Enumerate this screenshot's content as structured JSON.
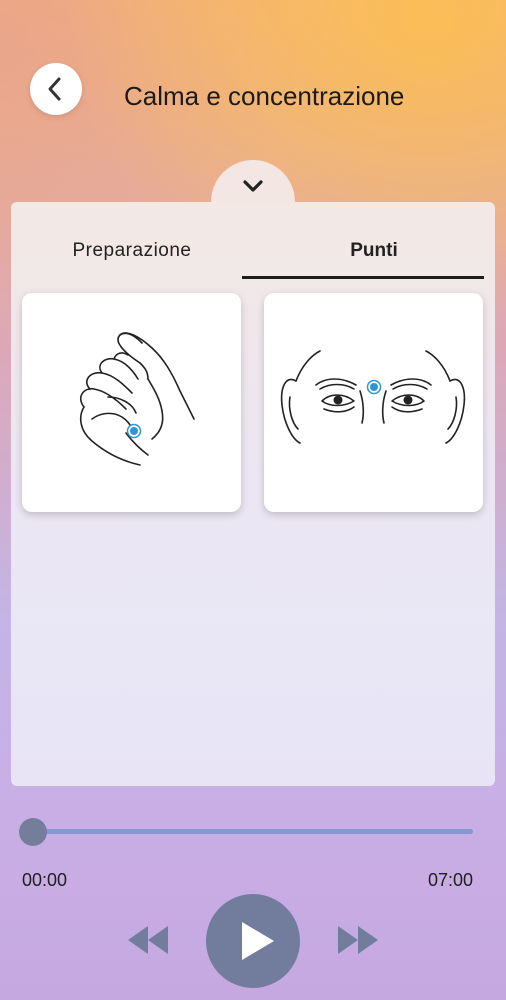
{
  "header": {
    "title": "Calma e concentrazione",
    "back_icon": "chevron-left-icon"
  },
  "panel": {
    "collapse_icon": "chevron-down-icon",
    "tabs": [
      {
        "label": "Preparazione",
        "active": false
      },
      {
        "label": "Punti",
        "active": true
      }
    ],
    "images": [
      {
        "name": "hand-illustration",
        "marker_color": "#2f96d6"
      },
      {
        "name": "face-illustration",
        "marker_color": "#2f96d6"
      }
    ]
  },
  "player": {
    "progress": 0,
    "elapsed": "00:00",
    "total": "07:00",
    "rewind_icon": "rewind-icon",
    "play_icon": "play-icon",
    "forward_icon": "fast-forward-icon"
  }
}
